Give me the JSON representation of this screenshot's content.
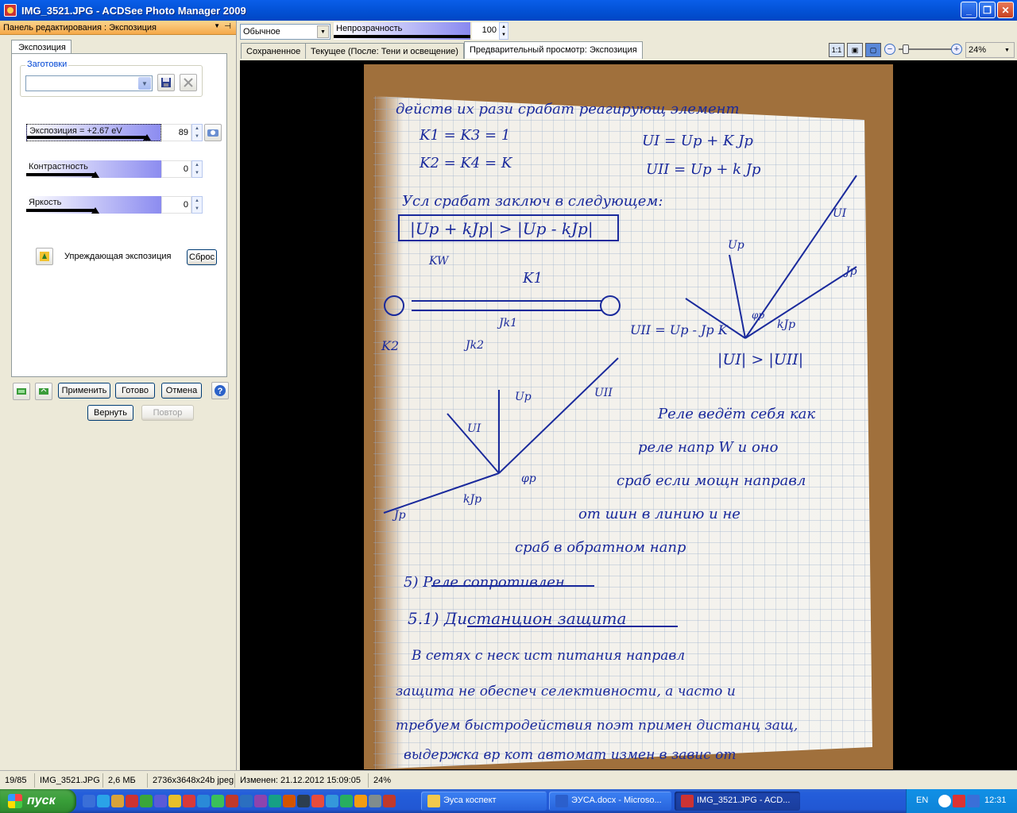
{
  "window": {
    "title": "IMG_3521.JPG - ACDSee Photo Manager 2009"
  },
  "left_panel": {
    "header": "Панель редактирования : Экспозиция",
    "tab": "Экспозиция",
    "presets_label": "Заготовки",
    "presets_value": "",
    "sliders": [
      {
        "label": "Экспозиция = +2.67 eV",
        "value": "89",
        "level": 0.89
      },
      {
        "label": "Контрастность",
        "value": "0",
        "level": 0.5
      },
      {
        "label": "Яркость",
        "value": "0",
        "level": 0.5
      }
    ],
    "auto_exposure_label": "Упреждающая экспозиция",
    "reset_label": "Сброс",
    "apply_label": "Применить",
    "done_label": "Готово",
    "cancel_label": "Отмена",
    "undo_label": "Вернуть",
    "redo_label": "Повтор"
  },
  "toolbar": {
    "blend_mode": "Обычное",
    "opacity_label": "Непрозрачность",
    "opacity_value": "100",
    "tabs": [
      "Сохраненное",
      "Текущее (После: Тени и освещение)",
      "Предварительный просмотр: Экспозиция"
    ],
    "zoom_value": "24%"
  },
  "photo": {
    "lines": [
      "действ их рази срабат реагирующ элемент",
      "K1 = K3 = 1",
      "K2 = K4 = K",
      "UI = Up + K Jp",
      "UII = Up + k Jp",
      "Усл срабат заключ в следующем:",
      "|Up + kJp| > |Up - kJp|",
      "KW",
      "K1",
      "Jk1",
      "K2",
      "Jk2",
      "Up",
      "UI",
      "Jp",
      "φp",
      "kJp",
      "UII = Up - Jp K",
      "|UI| > |UII|",
      "Up",
      "UII",
      "UI",
      "φp",
      "kJp",
      "Jp",
      "Реле ведёт себя как",
      "реле напр W и оно",
      "сраб если мощн направл",
      "от шин в линию и не",
      "сраб в обратном напр",
      "5) Реле сопротивлен",
      "5.1) Дистанцион защита",
      "В сетях с неск ист питания направл",
      "защита не обеспеч селективности, а часто и",
      "требуем быстродействия поэт примен дистанц защ,",
      "выдержка вр кот автомат измен в завис от"
    ]
  },
  "statusbar": {
    "index": "19/85",
    "filename": "IMG_3521.JPG",
    "size": "2,6 МБ",
    "dimensions": "2736x3648x24b jpeg",
    "modified": "Изменен: 21.12.2012 15:09:05",
    "zoom": "24%"
  },
  "taskbar": {
    "start": "пуск",
    "tasks": [
      "Эуса коспект",
      "ЭУСА.docx - Microso...",
      "IMG_3521.JPG - ACD..."
    ],
    "lang": "EN",
    "clock": "12:31"
  }
}
